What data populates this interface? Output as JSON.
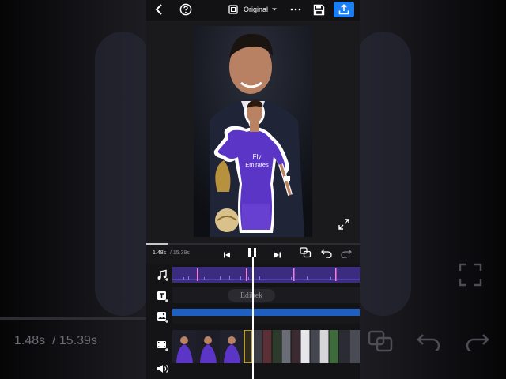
{
  "toolbar": {
    "back_icon": "chevron-left-icon",
    "help_icon": "question-circle-icon",
    "aspect_icon": "aspect-ratio-icon",
    "aspect_label": "Original",
    "more_icon": "more-icon",
    "save_icon": "save-icon",
    "export_icon": "upload-icon"
  },
  "preview": {
    "fullscreen_icon": "expand-icon",
    "sticker_text_1": "Fly",
    "sticker_text_2": "Emirates"
  },
  "transport": {
    "current_time": "1.48s",
    "total_time": "/ 15.39s",
    "prev_icon": "skip-previous-icon",
    "pause_icon": "pause-icon",
    "next_icon": "skip-next-icon",
    "keyframe_icon": "copy-layers-icon",
    "undo_icon": "undo-icon",
    "redo_icon": "redo-icon"
  },
  "tracks": {
    "audio_icon": "music-add-icon",
    "text_icon": "text-add-icon",
    "text_clip_label": "Edibek",
    "image_icon": "image-add-icon",
    "video_icon": "video-add-icon",
    "volume_icon": "volume-icon"
  },
  "background": {
    "time_current": "1.48s",
    "time_total": "/ 15.39s"
  },
  "colors": {
    "accent": "#1b7ff3",
    "audio_track": "#3b2c82",
    "jersey": "#5b36c6",
    "image_track": "#1f5fbf",
    "playhead": "#ffffff"
  }
}
